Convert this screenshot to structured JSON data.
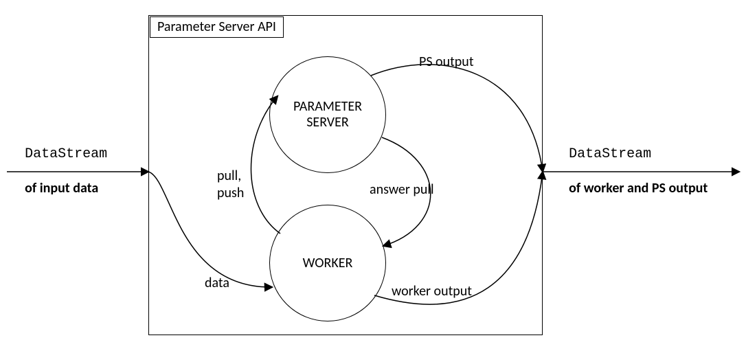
{
  "diagram": {
    "api_box_title": "Parameter Server API",
    "input_label_mono": "DataStream",
    "input_label_bold": "of input data",
    "output_label_mono": "DataStream",
    "output_label_bold": "of worker and PS output",
    "nodes": {
      "parameter_server": "PARAMETER\nSERVER",
      "worker": "WORKER"
    },
    "edges": {
      "pull_push": "pull,\npush",
      "answer_pull": "answer pull",
      "data": "data",
      "ps_output": "PS output",
      "worker_output": "worker output"
    }
  }
}
